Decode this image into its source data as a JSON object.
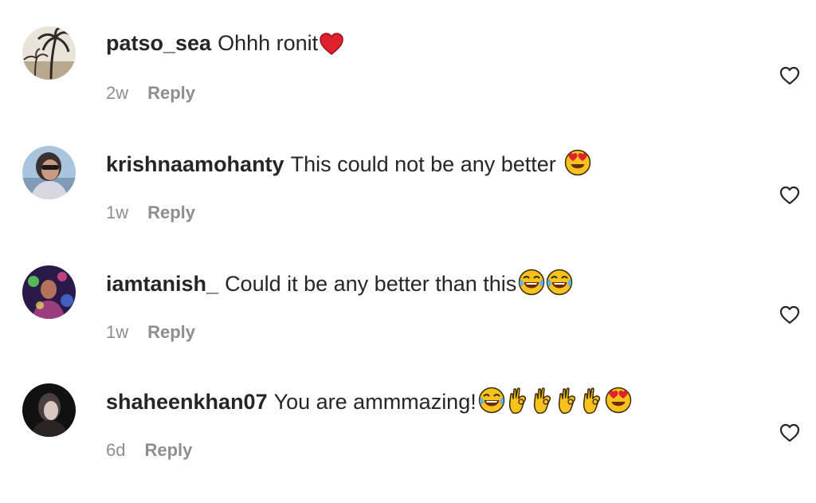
{
  "comments": [
    {
      "username": "patso_sea",
      "text": "Ohhh ronit",
      "emojis": [
        "red-heart"
      ],
      "time": "2w",
      "reply_label": "Reply",
      "avatar": "palm-tree-avatar"
    },
    {
      "username": "krishnaamohanty",
      "text": "This could not be any better",
      "emojis": [
        "heart-eyes"
      ],
      "time": "1w",
      "reply_label": "Reply",
      "avatar": "person-avatar"
    },
    {
      "username": "iamtanish_",
      "text": "Could it be any better than this",
      "emojis": [
        "joy",
        "joy"
      ],
      "time": "1w",
      "reply_label": "Reply",
      "avatar": "party-avatar"
    },
    {
      "username": "shaheenkhan07",
      "text": "You are ammmazing!",
      "emojis": [
        "joy",
        "ok-hand",
        "ok-hand",
        "ok-hand",
        "ok-hand",
        "heart-eyes"
      ],
      "time": "6d",
      "reply_label": "Reply",
      "avatar": "portrait-avatar"
    }
  ],
  "colors": {
    "text": "#262626",
    "meta": "#8e8e8e",
    "heart_outline": "#262626",
    "emoji_yellow": "#f7c21e",
    "emoji_red": "#e0202d"
  }
}
